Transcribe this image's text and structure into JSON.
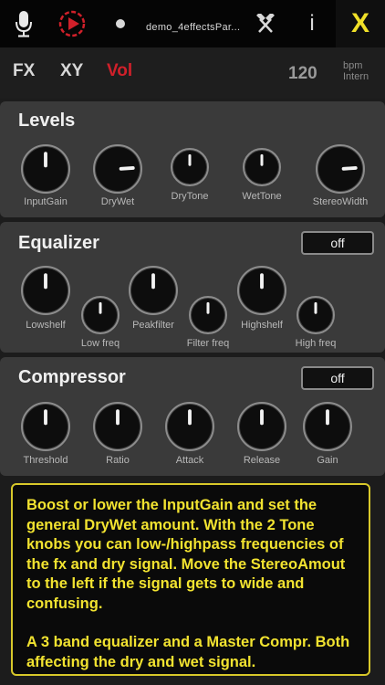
{
  "topbar": {
    "mic_icon": "microphone-icon",
    "play_icon": "play-record-icon",
    "dot_icon": "dot-icon",
    "filename": "demo_4effectsPar...",
    "tools_icon": "hammer-icon",
    "info_label": "i",
    "close_label": "X"
  },
  "nav": {
    "tabs": [
      "FX",
      "XY",
      "Vol"
    ],
    "active_tab": "Vol",
    "bpm_value": "120",
    "bpm_unit": "bpm",
    "bpm_source": "Intern"
  },
  "levels": {
    "title": "Levels",
    "knobs": [
      {
        "label": "InputGain",
        "value": 0.5
      },
      {
        "label": "DryWet",
        "value": 0.82
      },
      {
        "label": "DryTone",
        "value": 0.5
      },
      {
        "label": "WetTone",
        "value": 0.5
      },
      {
        "label": "StereoWidth",
        "value": 0.82
      }
    ]
  },
  "equalizer": {
    "title": "Equalizer",
    "toggle": "off",
    "knobs": [
      {
        "label": "Lowshelf",
        "value": 0.5
      },
      {
        "label": "Low freq",
        "value": 0.5
      },
      {
        "label": "Peakfilter",
        "value": 0.5
      },
      {
        "label": "Filter freq",
        "value": 0.5
      },
      {
        "label": "Highshelf",
        "value": 0.5
      },
      {
        "label": "High freq",
        "value": 0.5
      }
    ]
  },
  "compressor": {
    "title": "Compressor",
    "toggle": "off",
    "knobs": [
      {
        "label": "Threshold",
        "value": 0.5
      },
      {
        "label": "Ratio",
        "value": 0.5
      },
      {
        "label": "Attack",
        "value": 0.5
      },
      {
        "label": "Release",
        "value": 0.5
      },
      {
        "label": "Gain",
        "value": 0.5
      }
    ]
  },
  "help": {
    "paragraph1": "Boost or lower the InputGain and set the general DryWet amount. With the 2 Tone knobs you can low-/highpass frequencies of the fx and dry signal. Move the StereoAmout to the left if the signal gets to wide and confusing.",
    "paragraph2": "A 3 band equalizer and a Master Compr. Both affecting the dry and wet signal."
  },
  "colors": {
    "accent_red": "#d0202a",
    "help_yellow": "#f2e330",
    "close_yellow": "#f0e028"
  }
}
